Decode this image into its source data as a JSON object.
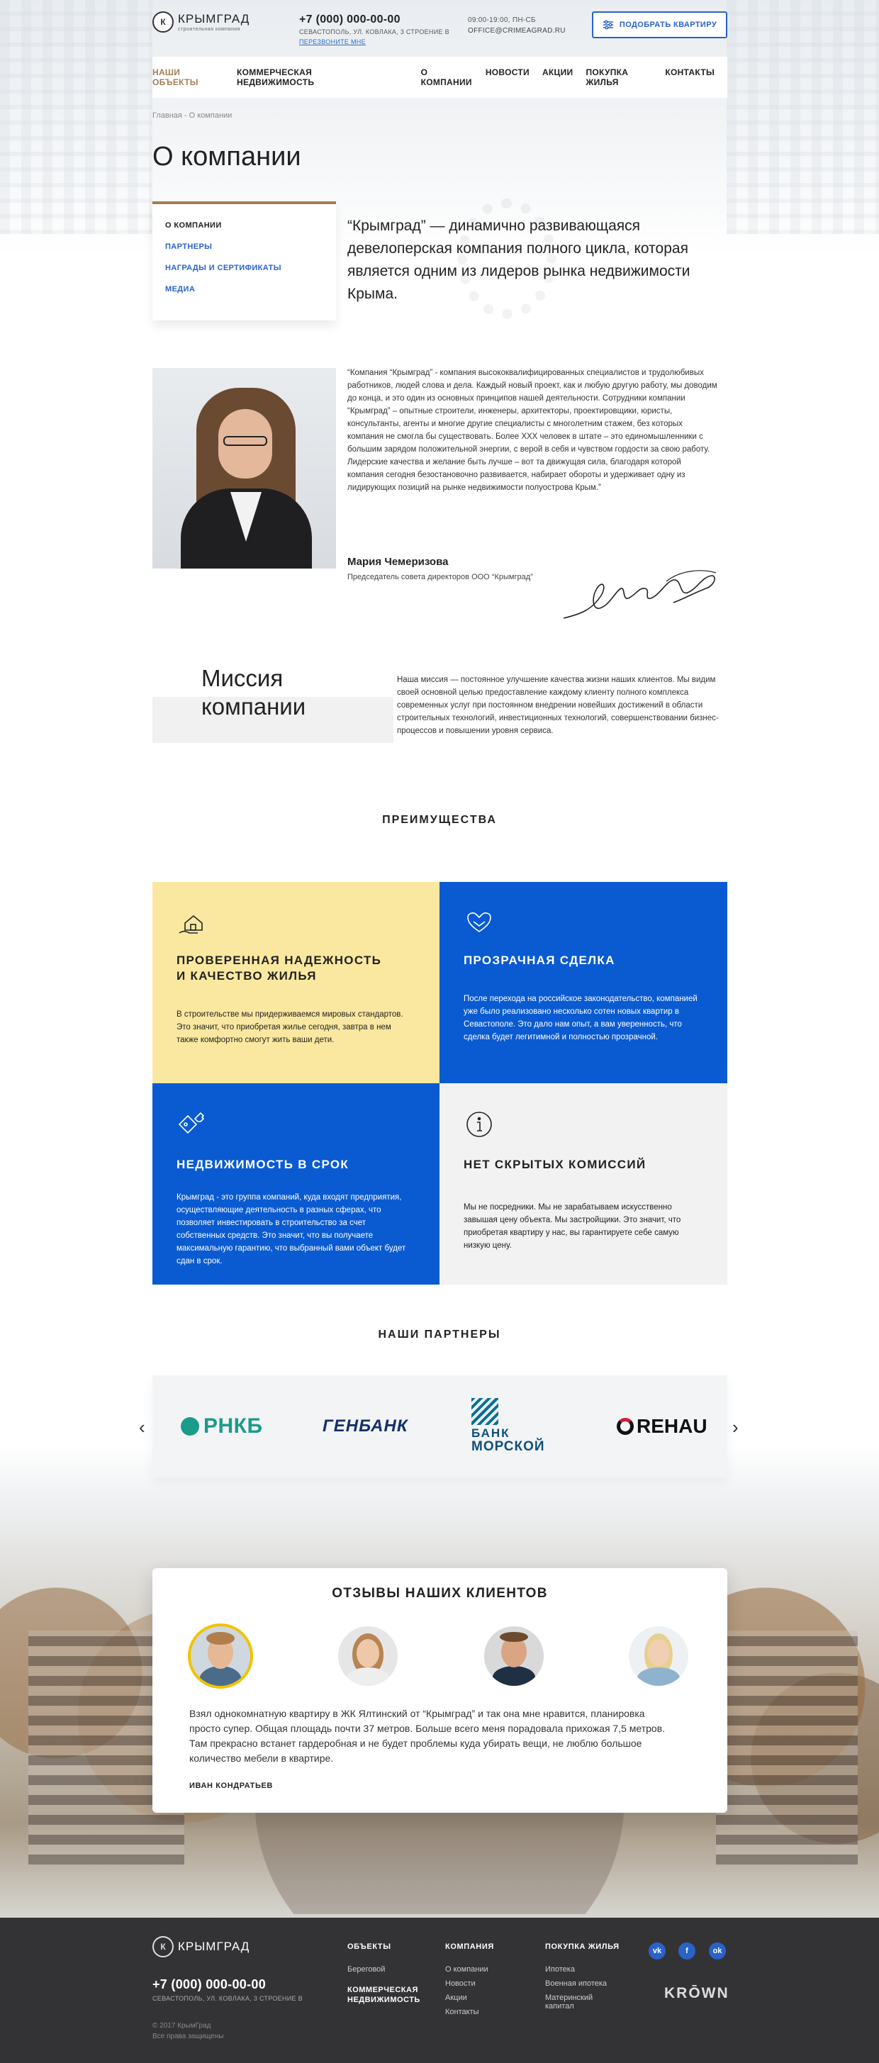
{
  "header": {
    "logo_mark": "К",
    "logo_name": "КРЫМГРАД",
    "logo_sub": "строительная компания",
    "phone": "+7 (000) 000-00-00",
    "address": "СЕВАСТОПОЛЬ, УЛ. КОВЛАКА, 3 СТРОЕНИЕ В",
    "callback": "ПЕРЕЗВОНИТЕ МНЕ",
    "hours": "09:00-19:00, ПН-СБ",
    "email": "OFFICE@CRIMEAGRAD.RU",
    "cta": "ПОДОБРАТЬ КВАРТИРУ"
  },
  "nav": {
    "left": [
      "НАШИ ОБЪЕКТЫ",
      "КОММЕРЧЕСКАЯ НЕДВИЖИМОСТЬ"
    ],
    "right": [
      "О КОМПАНИИ",
      "НОВОСТИ",
      "АКЦИИ",
      "ПОКУПКА ЖИЛЬЯ",
      "КОНТАКТЫ"
    ]
  },
  "breadcrumb": "Главная - О компании",
  "page_title": "О компании",
  "side_menu": [
    "О КОМПАНИИ",
    "ПАРТНЕРЫ",
    "НАГРАДЫ И СЕРТИФИКАТЫ",
    "МЕДИА"
  ],
  "intro": "“Крымград” — динамично развивающаяся девелоперская компания полного цикла, которая является одним из лидеров рынка недвижимости Крыма.",
  "quote": {
    "text": "“Компания “Крымград” - компания высококвалифицированных специалистов и трудолюбивых работников, людей слова и дела. Каждый новый проект, как и любую другую работу, мы доводим до конца, и это один из основных принципов нашей деятельности. Сотрудники компании “Крымград” – опытные строители, инженеры, архитекторы, проектировщики, юристы, консультанты, агенты и многие другие специалисты с многолетним стажем, без которых компания не смогла бы существовать. Более XXX человек в штате – это единомышленники с большим зарядом положительной энергии, с верой в себя и чувством гордости за свою работу. Лидерские качества и желание быть лучше – вот та движущая сила, благодаря которой компания сегодня безостановочно развивается, набирает обороты и удерживает одну из лидирующих позиций на рынке недвижимости полуострова Крым.”",
    "name": "Мария Чемеризова",
    "position": "Председатель совета директоров ООО “Крымград”"
  },
  "mission": {
    "title_line1": "Миссия",
    "title_line2": "компании",
    "text": "Наша миссия — постоянное улучшение качества жизни наших клиентов. Мы видим своей основной целью предоставление каждому клиенту полного комплекса современных услуг при постоянном внедрении новейших достижений в области строительных технологий, инвестиционных технологий, совершенствовании бизнес-процессов и повышении уровня сервиса."
  },
  "advantages": {
    "heading": "ПРЕИМУЩЕСТВА",
    "items": [
      {
        "title_1": "ПРОВЕРЕННАЯ НАДЕЖНОСТЬ",
        "title_2": "И КАЧЕСТВО ЖИЛЬЯ",
        "text": "В строительстве мы придерживаемся мировых стандартов. Это значит, что приобретая жилье сегодня, завтра в нем также комфортно смогут жить ваши дети.",
        "icon": "house-hand-icon"
      },
      {
        "title_1": "ПРОЗРАЧНАЯ СДЕЛКА",
        "title_2": "",
        "text": "После перехода на российское законодательство, компанией уже было реализовано несколько сотен новых квартир в Севастополе. Это дало нам опыт, а вам уверенность, что сделка будет легитимной и полностью прозрачной.",
        "icon": "handshake-icon"
      },
      {
        "title_1": "НЕДВИЖИМОСТЬ В СРОК",
        "title_2": "",
        "text": "Крымград - это группа компаний, куда входят предприятия, осуществляющие деятельность в разных сферах, что позволяет инвестировать в строительство за счет собственных средств. Это значит, что вы получаете максимальную гарантию, что выбранный вами объект будет сдан в срок.",
        "icon": "keys-icon"
      },
      {
        "title_1": "НЕТ СКРЫТЫХ КОМИССИЙ",
        "title_2": "",
        "text": "Мы не посредники. Мы не зарабатываем искусственно завышая цену объекта. Мы застройщики. Это значит, что приобретая квартиру у нас, вы гарантируете себе самую низкую цену.",
        "icon": "info-icon"
      }
    ]
  },
  "partners": {
    "heading": "НАШИ ПАРТНЕРЫ",
    "logos": [
      "РНКБ",
      "ГЕНБАНК",
      "БАНК",
      "МОРСКОЙ",
      "REHAU"
    ]
  },
  "reviews": {
    "heading": "ОТЗЫВЫ НАШИХ КЛИЕНТОВ",
    "text": "Взял однокомнатную квартиру в ЖК Ялтинский от “Крымград” и так она мне нравится, планировка просто супер. Общая площадь почти 37 метров. Больше всего меня порадовала прихожая 7,5 метров. Там прекрасно встанет гардеробная и не будет проблемы куда убирать вещи, не люблю большое количество мебели в квартире.",
    "author": "ИВАН КОНДРАТЬЕВ",
    "active_color": "#f2c200"
  },
  "footer": {
    "logo_name": "КРЫМГРАД",
    "phone": "+7 (000) 000-00-00",
    "address": "СЕВАСТОПОЛЬ, УЛ. КОВЛАКА, 3 СТРОЕНИЕ В",
    "copy_1": "© 2017 КрымГрад",
    "copy_2": "Все права защищены",
    "col1": {
      "title": "ОБЪЕКТЫ",
      "items": [
        "Береговой"
      ],
      "bold_1": "КОММЕРЧЕСКАЯ",
      "bold_2": "НЕДВИЖИМОСТЬ"
    },
    "col2": {
      "title": "КОМПАНИЯ",
      "items": [
        "О компании",
        "Новости",
        "Акции",
        "Контакты"
      ]
    },
    "col3": {
      "title": "ПОКУПКА ЖИЛЬЯ",
      "items": [
        "Ипотека",
        "Военная ипотека",
        "Материнский",
        "капитал"
      ]
    },
    "social": [
      "vk",
      "f",
      "ok"
    ],
    "brand": "KRŌWN"
  },
  "colors": {
    "accent": "#a57e55",
    "blue": "#0a5bd1",
    "yellow": "#fbe8a0",
    "footer": "#333335"
  }
}
